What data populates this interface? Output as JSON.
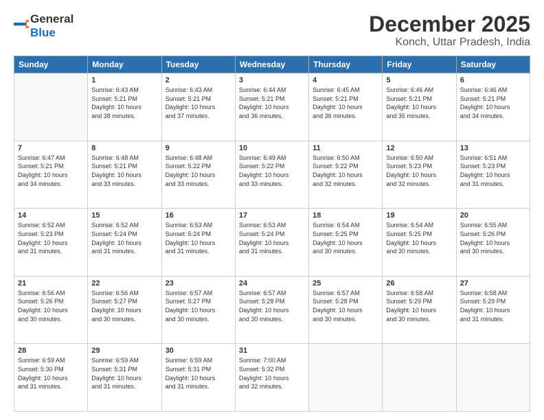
{
  "header": {
    "logo_general": "General",
    "logo_blue": "Blue",
    "month": "December 2025",
    "location": "Konch, Uttar Pradesh, India"
  },
  "weekdays": [
    "Sunday",
    "Monday",
    "Tuesday",
    "Wednesday",
    "Thursday",
    "Friday",
    "Saturday"
  ],
  "weeks": [
    [
      {
        "day": "",
        "info": ""
      },
      {
        "day": "1",
        "info": "Sunrise: 6:43 AM\nSunset: 5:21 PM\nDaylight: 10 hours\nand 38 minutes."
      },
      {
        "day": "2",
        "info": "Sunrise: 6:43 AM\nSunset: 5:21 PM\nDaylight: 10 hours\nand 37 minutes."
      },
      {
        "day": "3",
        "info": "Sunrise: 6:44 AM\nSunset: 5:21 PM\nDaylight: 10 hours\nand 36 minutes."
      },
      {
        "day": "4",
        "info": "Sunrise: 6:45 AM\nSunset: 5:21 PM\nDaylight: 10 hours\nand 36 minutes."
      },
      {
        "day": "5",
        "info": "Sunrise: 6:46 AM\nSunset: 5:21 PM\nDaylight: 10 hours\nand 35 minutes."
      },
      {
        "day": "6",
        "info": "Sunrise: 6:46 AM\nSunset: 5:21 PM\nDaylight: 10 hours\nand 34 minutes."
      }
    ],
    [
      {
        "day": "7",
        "info": "Sunrise: 6:47 AM\nSunset: 5:21 PM\nDaylight: 10 hours\nand 34 minutes."
      },
      {
        "day": "8",
        "info": "Sunrise: 6:48 AM\nSunset: 5:21 PM\nDaylight: 10 hours\nand 33 minutes."
      },
      {
        "day": "9",
        "info": "Sunrise: 6:48 AM\nSunset: 5:22 PM\nDaylight: 10 hours\nand 33 minutes."
      },
      {
        "day": "10",
        "info": "Sunrise: 6:49 AM\nSunset: 5:22 PM\nDaylight: 10 hours\nand 33 minutes."
      },
      {
        "day": "11",
        "info": "Sunrise: 6:50 AM\nSunset: 5:22 PM\nDaylight: 10 hours\nand 32 minutes."
      },
      {
        "day": "12",
        "info": "Sunrise: 6:50 AM\nSunset: 5:23 PM\nDaylight: 10 hours\nand 32 minutes."
      },
      {
        "day": "13",
        "info": "Sunrise: 6:51 AM\nSunset: 5:23 PM\nDaylight: 10 hours\nand 31 minutes."
      }
    ],
    [
      {
        "day": "14",
        "info": "Sunrise: 6:52 AM\nSunset: 5:23 PM\nDaylight: 10 hours\nand 31 minutes."
      },
      {
        "day": "15",
        "info": "Sunrise: 6:52 AM\nSunset: 5:24 PM\nDaylight: 10 hours\nand 31 minutes."
      },
      {
        "day": "16",
        "info": "Sunrise: 6:53 AM\nSunset: 5:24 PM\nDaylight: 10 hours\nand 31 minutes."
      },
      {
        "day": "17",
        "info": "Sunrise: 6:53 AM\nSunset: 5:24 PM\nDaylight: 10 hours\nand 31 minutes."
      },
      {
        "day": "18",
        "info": "Sunrise: 6:54 AM\nSunset: 5:25 PM\nDaylight: 10 hours\nand 30 minutes."
      },
      {
        "day": "19",
        "info": "Sunrise: 6:54 AM\nSunset: 5:25 PM\nDaylight: 10 hours\nand 30 minutes."
      },
      {
        "day": "20",
        "info": "Sunrise: 6:55 AM\nSunset: 5:26 PM\nDaylight: 10 hours\nand 30 minutes."
      }
    ],
    [
      {
        "day": "21",
        "info": "Sunrise: 6:56 AM\nSunset: 5:26 PM\nDaylight: 10 hours\nand 30 minutes."
      },
      {
        "day": "22",
        "info": "Sunrise: 6:56 AM\nSunset: 5:27 PM\nDaylight: 10 hours\nand 30 minutes."
      },
      {
        "day": "23",
        "info": "Sunrise: 6:57 AM\nSunset: 5:27 PM\nDaylight: 10 hours\nand 30 minutes."
      },
      {
        "day": "24",
        "info": "Sunrise: 6:57 AM\nSunset: 5:28 PM\nDaylight: 10 hours\nand 30 minutes."
      },
      {
        "day": "25",
        "info": "Sunrise: 6:57 AM\nSunset: 5:28 PM\nDaylight: 10 hours\nand 30 minutes."
      },
      {
        "day": "26",
        "info": "Sunrise: 6:58 AM\nSunset: 5:29 PM\nDaylight: 10 hours\nand 30 minutes."
      },
      {
        "day": "27",
        "info": "Sunrise: 6:58 AM\nSunset: 5:29 PM\nDaylight: 10 hours\nand 31 minutes."
      }
    ],
    [
      {
        "day": "28",
        "info": "Sunrise: 6:59 AM\nSunset: 5:30 PM\nDaylight: 10 hours\nand 31 minutes."
      },
      {
        "day": "29",
        "info": "Sunrise: 6:59 AM\nSunset: 5:31 PM\nDaylight: 10 hours\nand 31 minutes."
      },
      {
        "day": "30",
        "info": "Sunrise: 6:59 AM\nSunset: 5:31 PM\nDaylight: 10 hours\nand 31 minutes."
      },
      {
        "day": "31",
        "info": "Sunrise: 7:00 AM\nSunset: 5:32 PM\nDaylight: 10 hours\nand 32 minutes."
      },
      {
        "day": "",
        "info": ""
      },
      {
        "day": "",
        "info": ""
      },
      {
        "day": "",
        "info": ""
      }
    ]
  ]
}
